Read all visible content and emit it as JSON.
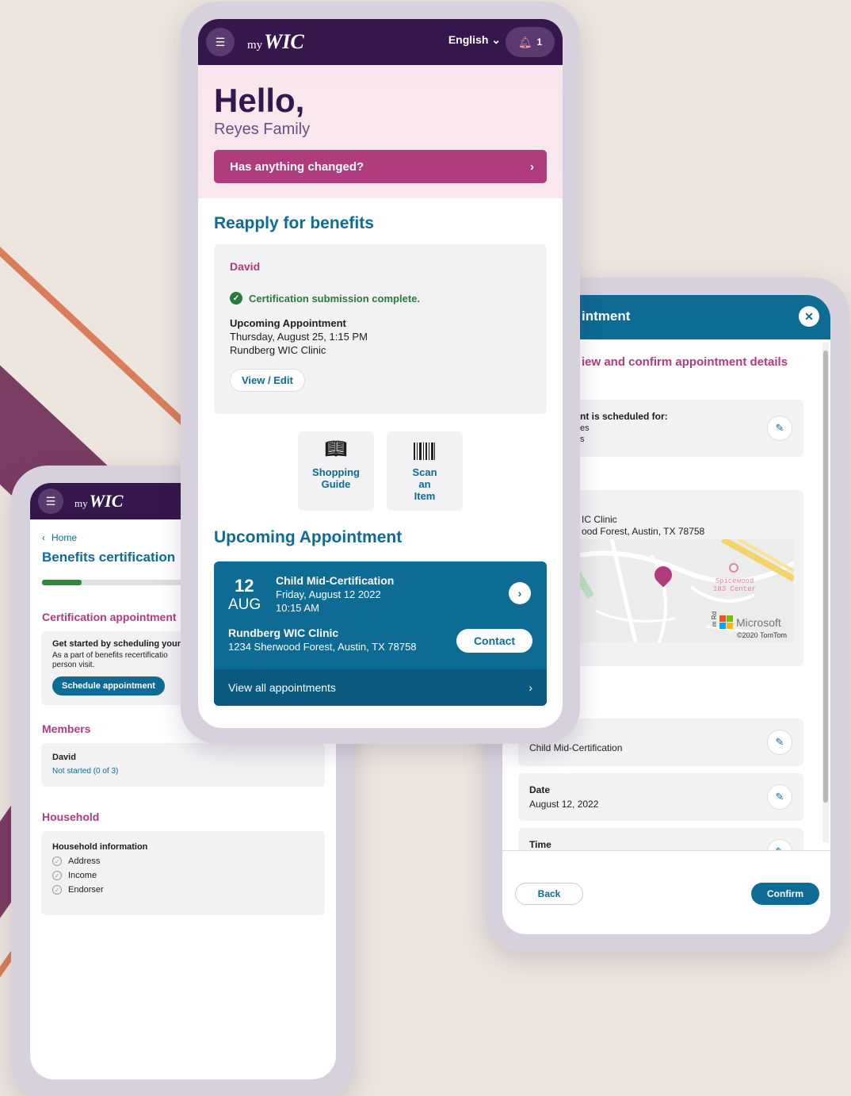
{
  "colors": {
    "accent": "#0e6b94",
    "brand_purple": "#35164d",
    "pink": "#b03c7d",
    "success": "#2a7a3a"
  },
  "brand": {
    "my": "my",
    "wic": "WIC"
  },
  "left_screen": {
    "breadcrumb": "Home",
    "title": "Benefits certification",
    "progress_fraction": 0.14,
    "cert_section": "Certification appointment",
    "cert_card": {
      "title": "Get started by scheduling your",
      "desc": "As a part of benefits recertificatio person visit.",
      "button": "Schedule appointment"
    },
    "members_section": "Members",
    "member": {
      "name": "David",
      "status": "Not started (0 of 3)"
    },
    "household_section": "Household",
    "household_card": {
      "title": "Household information",
      "items": [
        "Address",
        "Income",
        "Endorser"
      ]
    }
  },
  "right_screen": {
    "header_title": "intment",
    "subtitle": "iew and confirm appointment details",
    "scheduled_for": {
      "label": "nt is scheduled for:",
      "line1": "es",
      "line2": "s"
    },
    "location": {
      "line1": "IC Clinic",
      "line2": "ood Forest, Austin, TX 78758"
    },
    "map": {
      "place": "Spicewood",
      "place2": "183 Center",
      "brand": "Microsoft",
      "credit": "©2020 TomTom",
      "road": "m Rd"
    },
    "type_value": "Child Mid-Certification",
    "date": {
      "label": "Date",
      "value": "August 12, 2022"
    },
    "time": {
      "label": "Time"
    },
    "back": "Back",
    "confirm": "Confirm"
  },
  "center_screen": {
    "language": "English",
    "notifications": "1",
    "hello": "Hello,",
    "family": "Reyes Family",
    "changed_button": "Has anything changed?",
    "reapply_title": "Reapply for benefits",
    "cert_card": {
      "member": "David",
      "status": "Certification submission complete.",
      "upcoming_label": "Upcoming Appointment",
      "datetime": "Thursday, August 25, 1:15 PM",
      "clinic": "Rundberg WIC Clinic",
      "view_edit": "View / Edit"
    },
    "tiles": [
      {
        "label1": "Shopping",
        "label2": "Guide",
        "label3": "",
        "icon": "book-icon"
      },
      {
        "label1": "Scan",
        "label2": "an",
        "label3": "Item",
        "icon": "barcode-icon"
      }
    ],
    "upcoming_title": "Upcoming Appointment",
    "appointment": {
      "day": "12",
      "month": "AUG",
      "title": "Child Mid-Certification",
      "date": "Friday, August 12 2022",
      "time": "10:15 AM",
      "clinic": "Rundberg WIC Clinic",
      "address": "1234 Sherwood Forest, Austin, TX 78758",
      "contact": "Contact",
      "view_all": "View all appointments"
    }
  }
}
